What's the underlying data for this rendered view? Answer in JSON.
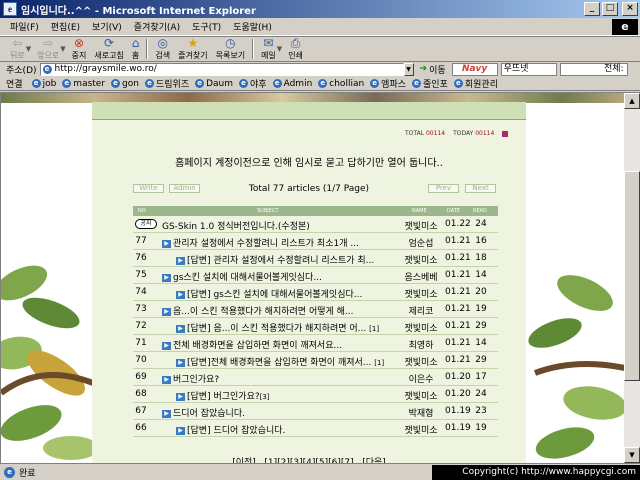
{
  "window": {
    "title": "임시입니다..^^ - Microsoft Internet Explorer"
  },
  "menu": [
    "파일(F)",
    "편집(E)",
    "보기(V)",
    "즐겨찾기(A)",
    "도구(T)",
    "도움말(H)"
  ],
  "toolbar": {
    "back": "뒤로",
    "forward": "앞으로",
    "stop": "중지",
    "refresh": "새로고침",
    "home": "홈",
    "search": "검색",
    "favorites": "즐겨찾기",
    "history": "목록보기",
    "mail": "메일",
    "print": "인쇄"
  },
  "address": {
    "label": "주소(D)",
    "url": "http://graysmile.wo.ro/",
    "go": "이동",
    "navy": "Navy",
    "search_value": "우뜨넷",
    "all_label": "전체:"
  },
  "links": {
    "label": "연결",
    "items": [
      "job",
      "master",
      "gon",
      "드림위즈",
      "Daum",
      "야후",
      "Admin",
      "chollian",
      "엠파스",
      "줄인포",
      "회원관리"
    ]
  },
  "board": {
    "counter_total_label": "TOTAL",
    "counter_total": "00114",
    "counter_today_label": "TODAY",
    "counter_today": "00114",
    "notice_text": "홈페이지 계정이전으로 인해 임시로 묻고 답하기만 열어 둡니다..",
    "total_articles": "Total 77 articles (1/7 Page)",
    "write_label": "Write",
    "admin_label": "Admin",
    "prev_label": "Prev",
    "next_label": "Next",
    "columns": {
      "no": "NO",
      "subject": "SUBJECT",
      "name": "NAME",
      "date": "DATE",
      "read": "READ"
    },
    "rows": [
      {
        "num": "공지",
        "subject": "GS-Skin 1.0 정식버전입니다.(수정본)",
        "name": "잿빛미소",
        "date": "01.22",
        "read": "24"
      },
      {
        "num": "77",
        "subject": "관리자 설정에서 수정할려니 리스트가 최소1개 ...",
        "name": "엄순섭",
        "date": "01.21",
        "read": "16"
      },
      {
        "num": "76",
        "subject": "[답변] 관리자 설정에서 수정할려니 리스트가 최...",
        "name": "잿빛미소",
        "date": "01.21",
        "read": "18"
      },
      {
        "num": "75",
        "subject": "gs스킨 설치에 대해서물어볼게잇심다...",
        "name": "음스베베",
        "date": "01.21",
        "read": "14"
      },
      {
        "num": "74",
        "subject": "[답변] gs스킨 설치에 대해서물어볼게잇심다...",
        "name": "잿빛미소",
        "date": "01.21",
        "read": "20"
      },
      {
        "num": "73",
        "subject": "음...이 스킨 적용했다가 해지하려면 어떻게 해...",
        "name": "제리코",
        "date": "01.21",
        "read": "19"
      },
      {
        "num": "72",
        "subject": "[답변] 음...이 스킨 적용했다가 해지하려면 어...",
        "extra": "[1]",
        "name": "잿빛미소",
        "date": "01.21",
        "read": "29"
      },
      {
        "num": "71",
        "subject": "전체 배경화면을 삽입하면 화면이 깨져서요...",
        "name": "최영하",
        "date": "01.21",
        "read": "14"
      },
      {
        "num": "70",
        "subject": "[답변]전체 배경화면을 삽입하면 화면이 깨져서...",
        "extra": "[1]",
        "name": "잿빛미소",
        "date": "01.21",
        "read": "29"
      },
      {
        "num": "69",
        "subject": "버그인가요?",
        "name": "이은수",
        "date": "01.20",
        "read": "17"
      },
      {
        "num": "68",
        "subject": "[답변] 버그인가요?",
        "extra": "[3]",
        "name": "잿빛미소",
        "date": "01.20",
        "read": "24"
      },
      {
        "num": "67",
        "subject": "드디어 잡았습니다.",
        "name": "박재형",
        "date": "01.19",
        "read": "23"
      },
      {
        "num": "66",
        "subject": "[답변] 드디어 잡았습니다.",
        "name": "잿빛미소",
        "date": "01.19",
        "read": "19"
      }
    ],
    "pager": "[이전]...[1][2][3][4][5][6][7]...[다음]"
  },
  "status": {
    "text": "완료",
    "copyright": "Copyright(c) http://www.happycgi.com"
  }
}
